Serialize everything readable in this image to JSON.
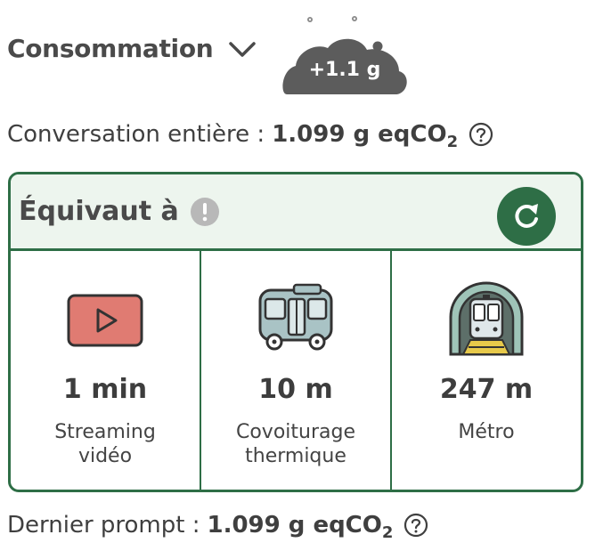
{
  "header": {
    "title": "Consommation",
    "chevron_icon": "chevron-down-icon"
  },
  "cloud": {
    "badge": "+1.1 g",
    "color": "#5c5c5c"
  },
  "total": {
    "label": "Conversation entière :",
    "value": "1.099 g eqCO",
    "subscript": "2",
    "help_icon": "question-circle-icon"
  },
  "card": {
    "title": "Équivaut à",
    "info_icon": "exclamation-circle-icon",
    "refresh_icon": "refresh-icon",
    "accent_color": "#2e6e46",
    "header_background": "#edf5ee",
    "items": [
      {
        "icon": "video-play-icon",
        "value": "1 min",
        "label": "Streaming vidéo"
      },
      {
        "icon": "bus-icon",
        "value": "10 m",
        "label": "Covoiturage thermique"
      },
      {
        "icon": "metro-icon",
        "value": "247 m",
        "label": "Métro"
      }
    ]
  },
  "last_prompt": {
    "label": "Dernier prompt :",
    "value": "1.099 g eqCO",
    "subscript": "2",
    "help_icon": "question-circle-icon"
  }
}
